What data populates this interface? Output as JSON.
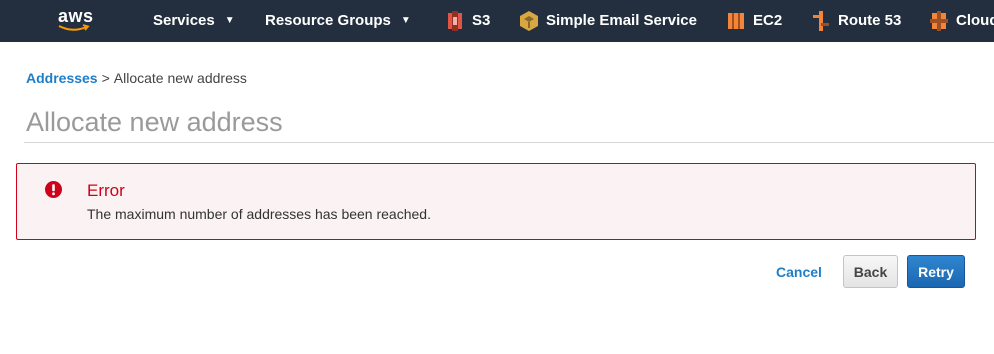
{
  "nav": {
    "logo_text": "aws",
    "services_label": "Services",
    "resource_groups_label": "Resource Groups",
    "shortcuts": [
      {
        "label": "S3",
        "icon": "s3-icon",
        "color": "#e25444"
      },
      {
        "label": "Simple Email Service",
        "icon": "ses-icon",
        "color": "#d9a741"
      },
      {
        "label": "EC2",
        "icon": "ec2-icon",
        "color": "#f58536"
      },
      {
        "label": "Route 53",
        "icon": "route53-icon",
        "color": "#f58536"
      },
      {
        "label": "Cloud",
        "icon": "cloudfront-icon",
        "color": "#f58536"
      }
    ]
  },
  "breadcrumb": {
    "parent": "Addresses",
    "separator": ">",
    "current": "Allocate new address"
  },
  "page": {
    "title": "Allocate new address"
  },
  "error": {
    "title": "Error",
    "message": "The maximum number of addresses has been reached."
  },
  "actions": {
    "cancel": "Cancel",
    "back": "Back",
    "retry": "Retry"
  },
  "colors": {
    "nav_bg": "#232f3e",
    "link": "#1e7ec8",
    "error": "#d0021b",
    "primary": "#1b67b0"
  }
}
